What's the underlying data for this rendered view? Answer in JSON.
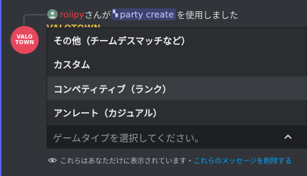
{
  "reply": {
    "username": "roiipy",
    "text_before": "さんが",
    "command": "party create",
    "text_after": "を使用しました"
  },
  "bot": {
    "avatar_line1": "VALO",
    "avatar_line2": "TOWN",
    "name_partial": "VALOTOWN"
  },
  "select_menu": {
    "options": [
      "その他（チームデスマッチなど）",
      "カスタム",
      "コンペティティブ（ランク）",
      "アンレート（カジュアル）"
    ],
    "hovered_option": "コンペティティブ（ランク）",
    "placeholder": "ゲームタイプを選択してください。",
    "expanded": true
  },
  "ephemeral_notice": {
    "text": "これらはあなただけに表示されています・",
    "link": "これらのメッセージを削除する"
  },
  "colors": {
    "accent": "#5865f2",
    "link": "#00a8fc",
    "username": "#f23f42",
    "bot_name": "#d9b33f",
    "avatar_bg": "#e8475d"
  }
}
